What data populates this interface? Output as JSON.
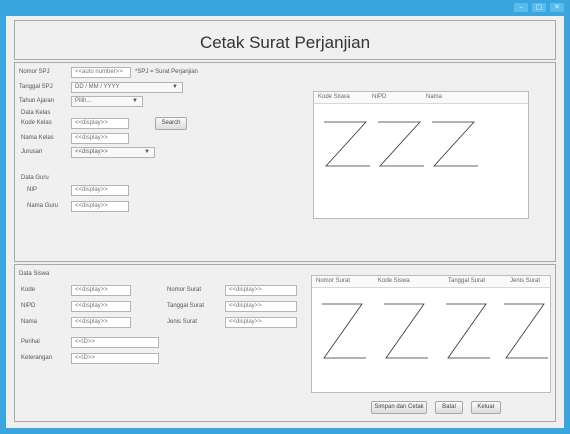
{
  "window": {
    "controls": [
      "–",
      "□",
      "✕"
    ]
  },
  "header": {
    "title": "Cetak Surat Perjanjian"
  },
  "top": {
    "nomor_spj_label": "Nomor SPJ",
    "nomor_spj_value": "<<auto number>>",
    "nomor_spj_note": "*SPJ = Surat Perjanjian",
    "tanggal_spj_label": "Tanggal SPJ",
    "tanggal_spj_value": "DD / MM / YYYY",
    "tahun_ajaran_label": "Tahun Ajaran",
    "tahun_ajaran_value": "Pilih...",
    "data_kelas_label": "Data Kelas",
    "kode_kelas_label": "Kode Kelas",
    "kode_kelas_value": "<<display>>",
    "search_button": "Search",
    "nama_kelas_label": "Nama Kelas",
    "nama_kelas_value": "<<display>>",
    "jurusan_label": "Jurusan",
    "jurusan_value": "<<display>>",
    "data_guru_label": "Data Guru",
    "nip_label": "NIP",
    "nip_value": "<<display>>",
    "nama_guru_label": "Nama Guru",
    "nama_guru_value": "<<display>>",
    "table_headers": [
      "Kode Siswa",
      "NIPD",
      "Nama"
    ]
  },
  "bottom": {
    "data_siswa_label": "Data Siswa",
    "kode_label": "Kode",
    "kode_value": "<<display>>",
    "nipd_label": "NIPD",
    "nipd_value": "<<display>>",
    "nama_label": "Nama",
    "nama_value": "<<display>>",
    "nomor_surat_label": "Nomor Surat",
    "nomor_surat_value": "<<display>>",
    "tanggal_surat_label": "Tanggal Surat",
    "tanggal_surat_value": "<<display>>",
    "jenis_surat_label": "Jenis Surat",
    "jenis_surat_value": "<<display>>",
    "perihal_label": "Perihal",
    "perihal_value": "<<ID>>",
    "keterangan_label": "Keterangan",
    "keterangan_value": "<<ID>>",
    "table_headers": [
      "Nomor Surat",
      "Kode Siswa",
      "Tanggal Surat",
      "Jenis Surat"
    ],
    "buttons": {
      "simpan": "Simpan dan Cetak",
      "batal": "Batal",
      "keluar": "Keluar"
    }
  }
}
